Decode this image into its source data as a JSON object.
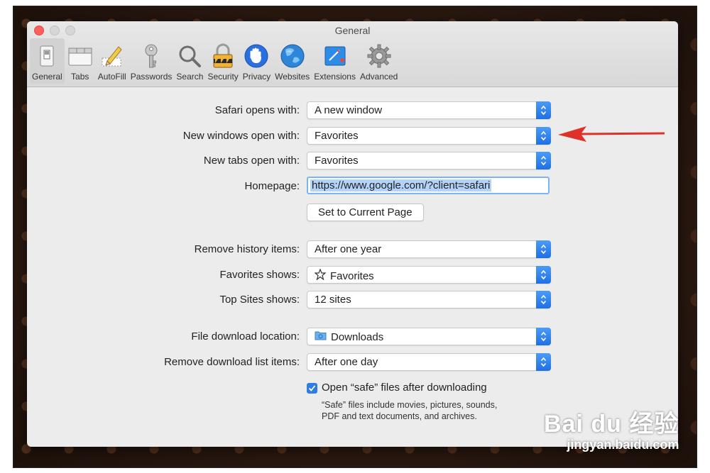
{
  "window": {
    "title": "General"
  },
  "toolbar": {
    "items": [
      {
        "label": "General",
        "icon": "general-switch-icon"
      },
      {
        "label": "Tabs",
        "icon": "tabs-icon"
      },
      {
        "label": "AutoFill",
        "icon": "pencil-icon"
      },
      {
        "label": "Passwords",
        "icon": "key-icon"
      },
      {
        "label": "Search",
        "icon": "magnifier-icon"
      },
      {
        "label": "Security",
        "icon": "padlock-icon"
      },
      {
        "label": "Privacy",
        "icon": "hand-icon"
      },
      {
        "label": "Websites",
        "icon": "globe-icon"
      },
      {
        "label": "Extensions",
        "icon": "puzzle-icon"
      },
      {
        "label": "Advanced",
        "icon": "gear-icon"
      }
    ],
    "active": "General"
  },
  "settings": {
    "safari_opens_with": {
      "label": "Safari opens with:",
      "value": "A new window"
    },
    "new_windows_open_with": {
      "label": "New windows open with:",
      "value": "Favorites"
    },
    "new_tabs_open_with": {
      "label": "New tabs open with:",
      "value": "Favorites"
    },
    "homepage": {
      "label": "Homepage:",
      "value": "https://www.google.com/?client=safari"
    },
    "set_current_page": {
      "label": "Set to Current Page"
    },
    "remove_history_items": {
      "label": "Remove history items:",
      "value": "After one year"
    },
    "favorites_shows": {
      "label": "Favorites shows:",
      "value": "Favorites",
      "icon": "star-icon"
    },
    "top_sites_shows": {
      "label": "Top Sites shows:",
      "value": "12 sites"
    },
    "file_download_location": {
      "label": "File download location:",
      "value": "Downloads",
      "icon": "folder-icon"
    },
    "remove_download_list_items": {
      "label": "Remove download list items:",
      "value": "After one day"
    },
    "open_safe_files": {
      "label": "Open “safe” files after downloading",
      "checked": true,
      "note": "“Safe” files include movies, pictures, sounds, PDF and text documents, and archives."
    }
  },
  "annotation": {
    "arrow_color": "#e0302a"
  },
  "watermark": {
    "brand": "Bai du 经验",
    "url": "jingyan.baidu.com"
  },
  "colors": {
    "accent": "#1f6fe5",
    "close": "#fc605c"
  }
}
